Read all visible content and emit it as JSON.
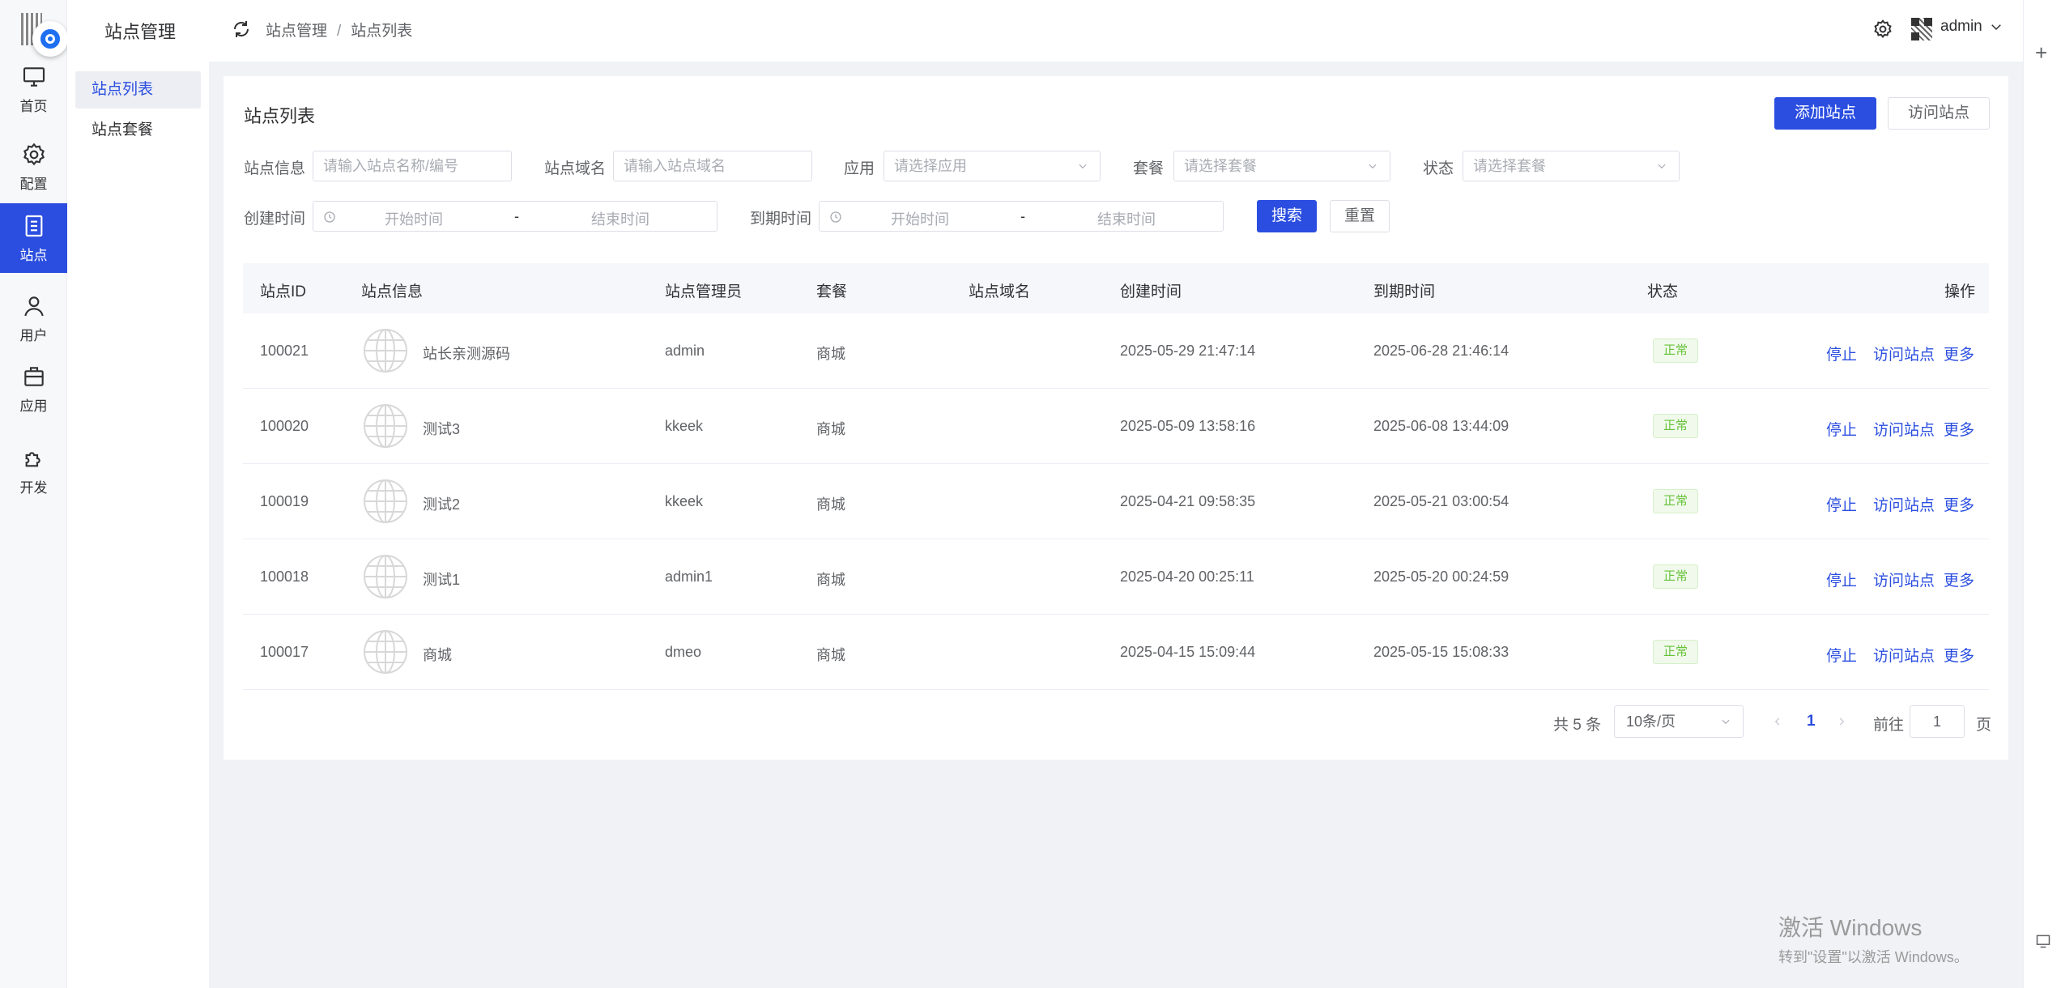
{
  "rail": {
    "items": [
      {
        "label": "首页",
        "icon": "monitor-icon"
      },
      {
        "label": "配置",
        "icon": "gear-icon"
      },
      {
        "label": "站点",
        "icon": "document-icon"
      },
      {
        "label": "用户",
        "icon": "user-icon"
      },
      {
        "label": "应用",
        "icon": "briefcase-icon"
      },
      {
        "label": "开发",
        "icon": "puzzle-icon"
      }
    ],
    "active_index": 2
  },
  "submenu": {
    "title": "站点管理",
    "items": [
      {
        "label": "站点列表"
      },
      {
        "label": "站点套餐"
      }
    ]
  },
  "header": {
    "breadcrumb": [
      "站点管理",
      "站点列表"
    ],
    "breadcrumb_sep": "/",
    "user_name": "admin"
  },
  "card": {
    "title": "站点列表",
    "add_button": "添加站点",
    "visit_button": "访问站点"
  },
  "filters": {
    "site_info": {
      "label": "站点信息",
      "placeholder": "请输入站点名称/编号"
    },
    "domain": {
      "label": "站点域名",
      "placeholder": "请输入站点域名"
    },
    "app": {
      "label": "应用",
      "placeholder": "请选择应用"
    },
    "package": {
      "label": "套餐",
      "placeholder": "请选择套餐"
    },
    "status": {
      "label": "状态",
      "placeholder": "请选择套餐"
    },
    "create_time": {
      "label": "创建时间",
      "start": "开始时间",
      "end": "结束时间",
      "sep": "-"
    },
    "expire_time": {
      "label": "到期时间",
      "start": "开始时间",
      "end": "结束时间",
      "sep": "-"
    },
    "search_button": "搜索",
    "reset_button": "重置"
  },
  "table": {
    "columns": [
      "站点ID",
      "站点信息",
      "站点管理员",
      "套餐",
      "站点域名",
      "创建时间",
      "到期时间",
      "状态",
      "操作"
    ],
    "rows": [
      {
        "id": "100021",
        "name": "站长亲测源码",
        "admin": "admin",
        "package": "商城",
        "domain": "",
        "created": "2025-05-29 21:47:14",
        "expires": "2025-06-28 21:46:14",
        "status": "正常"
      },
      {
        "id": "100020",
        "name": "测试3",
        "admin": "kkeek",
        "package": "商城",
        "domain": "",
        "created": "2025-05-09 13:58:16",
        "expires": "2025-06-08 13:44:09",
        "status": "正常"
      },
      {
        "id": "100019",
        "name": "测试2",
        "admin": "kkeek",
        "package": "商城",
        "domain": "",
        "created": "2025-04-21 09:58:35",
        "expires": "2025-05-21 03:00:54",
        "status": "正常"
      },
      {
        "id": "100018",
        "name": "测试1",
        "admin": "admin1",
        "package": "商城",
        "domain": "",
        "created": "2025-04-20 00:25:11",
        "expires": "2025-05-20 00:24:59",
        "status": "正常"
      },
      {
        "id": "100017",
        "name": "商城",
        "admin": "dmeo",
        "package": "商城",
        "domain": "",
        "created": "2025-04-15 15:09:44",
        "expires": "2025-05-15 15:08:33",
        "status": "正常"
      }
    ],
    "actions": {
      "stop": "停止",
      "visit": "访问站点",
      "more": "更多"
    }
  },
  "pagination": {
    "total": "共 5 条",
    "page_size": "10条/页",
    "current_page": "1",
    "goto_label": "前往",
    "goto_value": "1",
    "page_unit": "页"
  },
  "watermark": {
    "line1": "激活 Windows",
    "line2": "转到\"设置\"以激活 Windows。"
  },
  "colors": {
    "primary": "#2b4ee0",
    "success": "#67c23a",
    "background": "#f0f2f5"
  }
}
